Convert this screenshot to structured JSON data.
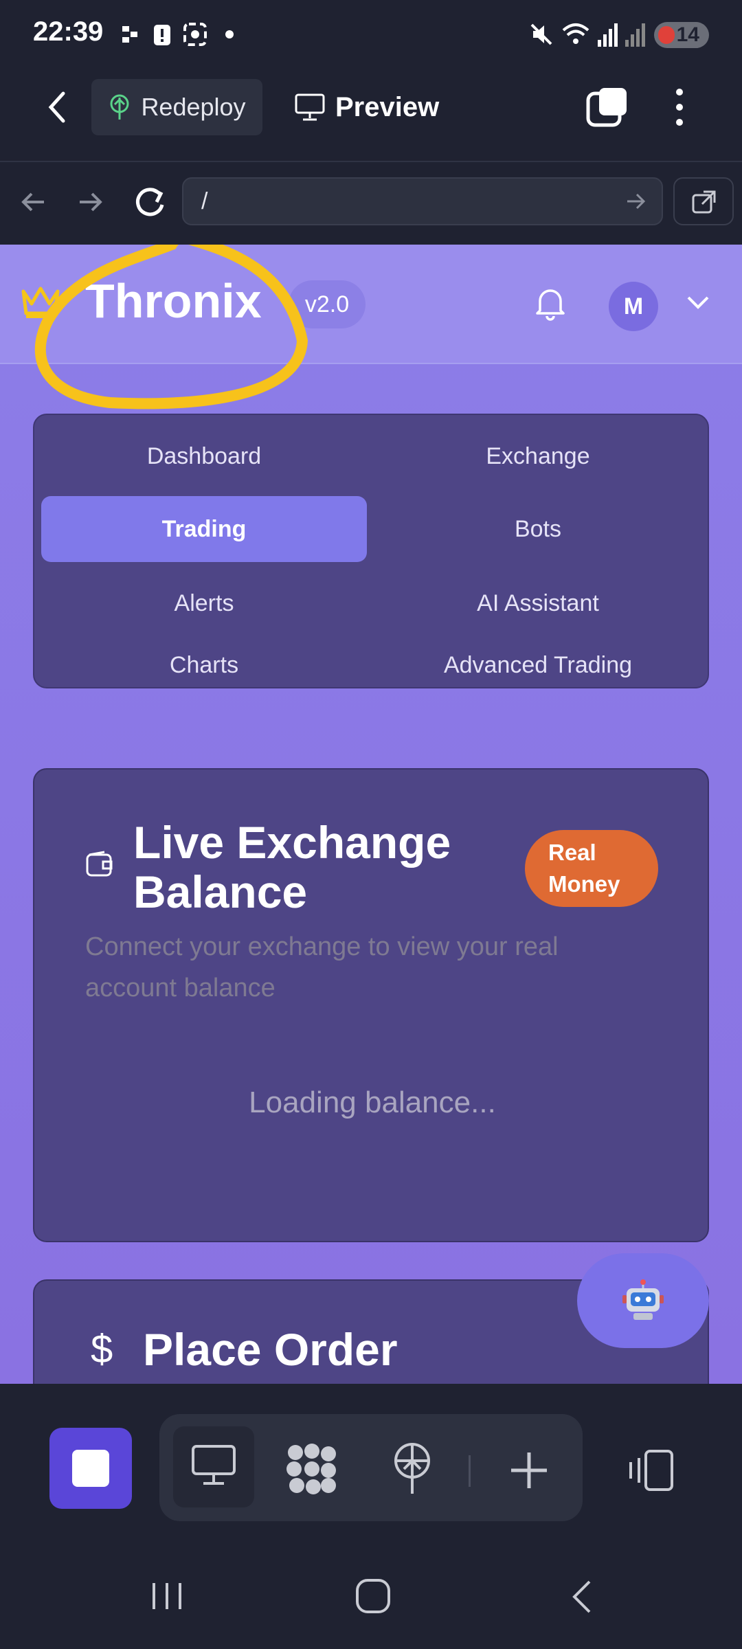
{
  "status_bar": {
    "time": "22:39",
    "battery": "14"
  },
  "app_bar": {
    "redeploy_label": "Redeploy",
    "preview_label": "Preview"
  },
  "browser": {
    "url": "/"
  },
  "site": {
    "brand": "Thronix",
    "version": "v2.0",
    "avatar_initial": "M",
    "nav": [
      {
        "label": "Dashboard"
      },
      {
        "label": "Exchange"
      },
      {
        "label": "Trading",
        "active": true
      },
      {
        "label": "Bots"
      },
      {
        "label": "Alerts"
      },
      {
        "label": "AI Assistant"
      },
      {
        "label": "Charts"
      },
      {
        "label": "Advanced Trading"
      }
    ],
    "balance_card": {
      "title": "Live Exchange Balance",
      "badge": "Real Money",
      "subtitle": "Connect your exchange to view your real account balance",
      "loading": "Loading balance..."
    },
    "order_card": {
      "title": "Place Order",
      "symbol": "$"
    },
    "assistant_icon": "robot-icon"
  },
  "colors": {
    "accent": "#8079ea",
    "brand_gold": "#f5c518",
    "badge": "#df6a33",
    "annotation": "#f7c21b"
  }
}
